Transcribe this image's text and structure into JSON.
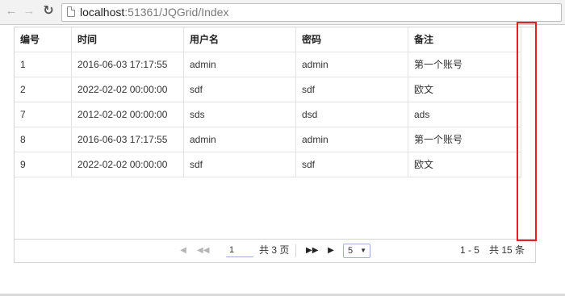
{
  "browser": {
    "url_host": "localhost",
    "url_rest": ":51361/JQGrid/Index"
  },
  "grid": {
    "columns": [
      "编号",
      "时间",
      "用户名",
      "密码",
      "备注"
    ],
    "rows": [
      [
        "1",
        "2016-06-03 17:17:55",
        "admin",
        "admin",
        "第一个账号"
      ],
      [
        "2",
        "2022-02-02 00:00:00",
        "sdf",
        "sdf",
        "欧文"
      ],
      [
        "7",
        "2012-02-02 00:00:00",
        "sds",
        "dsd",
        "ads"
      ],
      [
        "8",
        "2016-06-03 17:17:55",
        "admin",
        "admin",
        "第一个账号"
      ],
      [
        "9",
        "2022-02-02 00:00:00",
        "sdf",
        "sdf",
        "欧文"
      ]
    ]
  },
  "pager": {
    "current_page": "1",
    "total_pages_text": "共 3 页",
    "rows_per_page": "5",
    "record_info": "1 - 5　共 15 条"
  },
  "colors": {
    "annotation": "#e52020",
    "grid_border": "#d4d4d4"
  }
}
